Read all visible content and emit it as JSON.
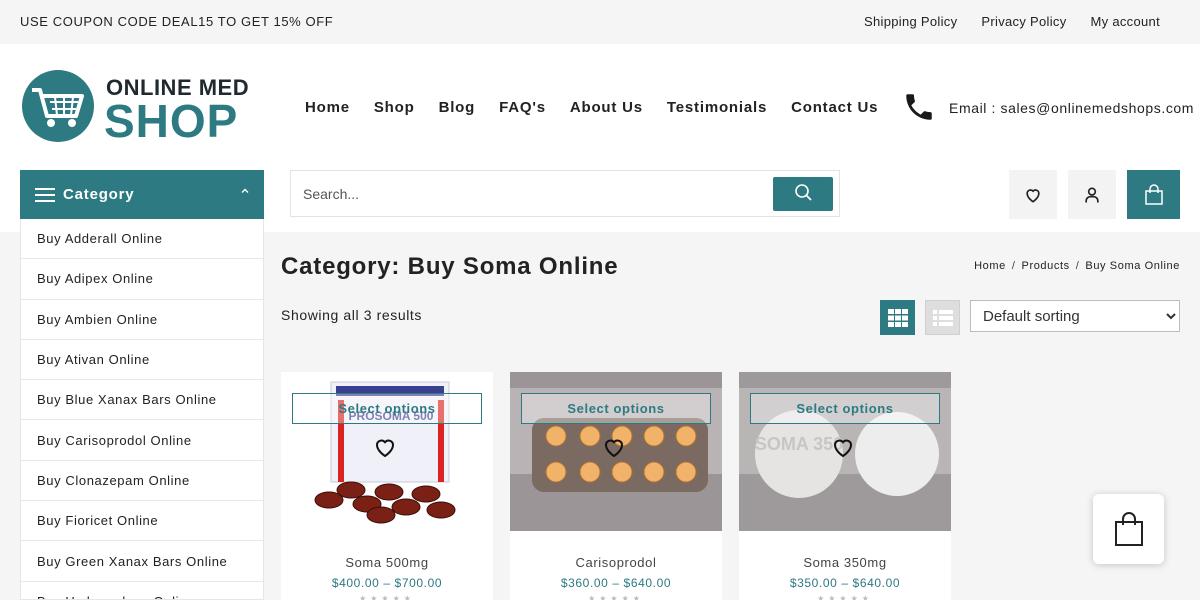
{
  "topbar": {
    "coupon": "USE COUPON CODE DEAL15 TO GET 15% OFF",
    "links": [
      "Shipping Policy",
      "Privacy Policy",
      "My account"
    ]
  },
  "logo": {
    "line1": "ONLINE MED",
    "line2": "SHOP"
  },
  "nav": [
    "Home",
    "Shop",
    "Blog",
    "FAQ's",
    "About Us",
    "Testimonials",
    "Contact Us"
  ],
  "contact": {
    "email": "Email : sales@onlinemedshops.com"
  },
  "category": {
    "label": "Category",
    "items": [
      "Buy Adderall Online",
      "Buy Adipex Online",
      "Buy Ambien Online",
      "Buy Ativan Online",
      "Buy Blue Xanax Bars Online",
      "Buy Carisoprodol Online",
      "Buy Clonazepam Online",
      "Buy Fioricet Online",
      "Buy Green Xanax Bars Online",
      "Buy Hydrocodone Online"
    ]
  },
  "search": {
    "placeholder": "Search..."
  },
  "page": {
    "title": "Category: Buy Soma Online",
    "breadcrumb": [
      "Home",
      "Products",
      "Buy Soma Online"
    ],
    "results": "Showing all 3 results",
    "sorting": "Default sorting"
  },
  "products": [
    {
      "name": "Soma 500mg",
      "price": "$400.00 – $700.00",
      "button": "Select options",
      "box_text": "PROSOMA 500"
    },
    {
      "name": "Carisoprodol",
      "price": "$360.00 – $640.00",
      "button": "Select options"
    },
    {
      "name": "Soma 350mg",
      "price": "$350.00 – $640.00",
      "button": "Select options",
      "pill_text": "SOMA 350"
    }
  ],
  "colors": {
    "accent": "#2d7a82",
    "topbar_bg": "#f5f5f5"
  }
}
